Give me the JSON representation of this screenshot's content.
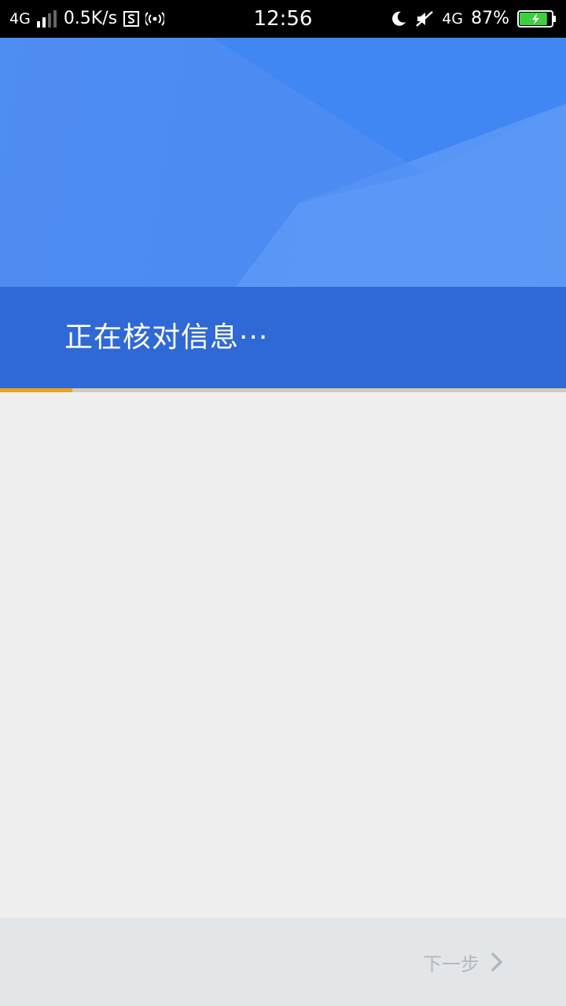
{
  "status_bar": {
    "network_left": "4G",
    "speed": "0.5K/s",
    "time": "12:56",
    "network_right": "4G",
    "battery": "87%",
    "battery_level": 0.87,
    "icons": [
      "signal-icon",
      "s-app-icon",
      "hotspot-icon",
      "moon-icon",
      "mute-icon",
      "battery-charging-icon"
    ]
  },
  "header": {
    "title": "正在核对信息···",
    "colors": {
      "primary": "#4a8af2",
      "band": "#2f69d6"
    }
  },
  "progress": {
    "value": 0.128,
    "color": "#e8a21c"
  },
  "footer": {
    "next_label": "下一步",
    "next_icon": "chevron-right-icon"
  }
}
